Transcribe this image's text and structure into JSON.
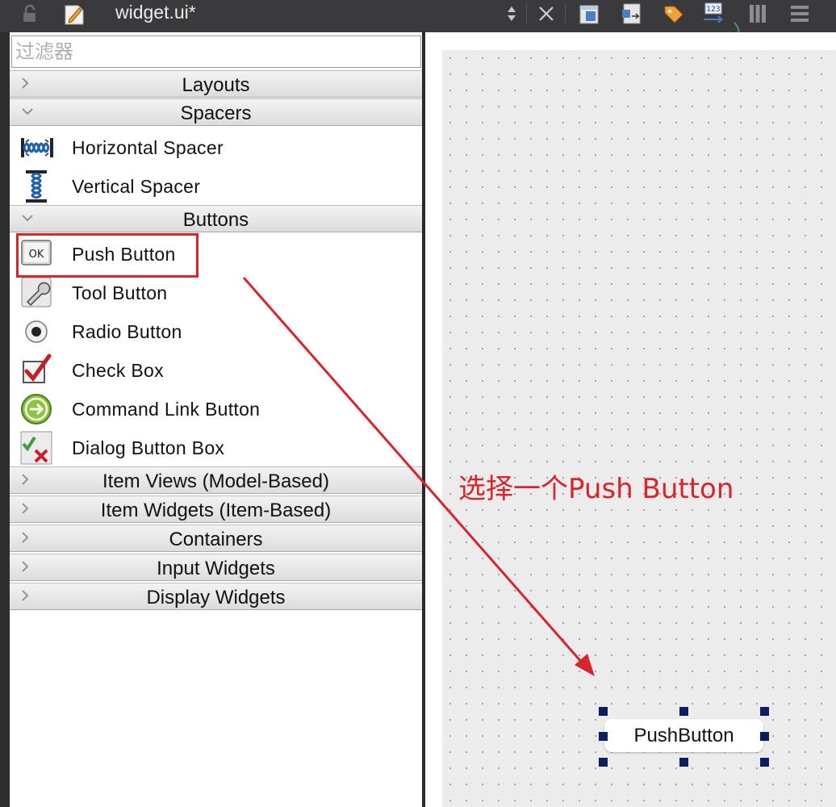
{
  "toolbar": {
    "title": "widget.ui*",
    "icons": [
      "lock-icon",
      "edit-icon",
      "spin-arrows-icon",
      "close-icon",
      "layout-icon",
      "layout-icon",
      "tag-icon",
      "tab-order-icon",
      "columns-icon",
      "rows-icon"
    ]
  },
  "widget_box": {
    "filter_placeholder": "过滤器",
    "categories": {
      "layouts": "Layouts",
      "spacers": "Spacers",
      "buttons": "Buttons",
      "item_views": "Item Views (Model-Based)",
      "item_widgets": "Item Widgets (Item-Based)",
      "containers": "Containers",
      "input_widgets": "Input Widgets",
      "display_widgets": "Display Widgets"
    },
    "spacers": [
      {
        "label": "Horizontal Spacer",
        "icon": "horizontal-spacer-icon"
      },
      {
        "label": "Vertical Spacer",
        "icon": "vertical-spacer-icon"
      }
    ],
    "buttons": [
      {
        "label": "Push Button",
        "icon": "push-button-icon",
        "icon_text": "OK"
      },
      {
        "label": "Tool Button",
        "icon": "tool-button-icon"
      },
      {
        "label": "Radio Button",
        "icon": "radio-button-icon"
      },
      {
        "label": "Check Box",
        "icon": "check-box-icon"
      },
      {
        "label": "Command Link Button",
        "icon": "command-link-icon"
      },
      {
        "label": "Dialog Button Box",
        "icon": "dialog-button-box-icon"
      }
    ]
  },
  "canvas": {
    "annotation": "选择一个Push Button",
    "push_button_label": "PushButton"
  },
  "colors": {
    "annotation_red": "#d9232d",
    "handle_navy": "#0f1c5e",
    "canvas_bg": "#ececec",
    "toolbar_bg": "#3a3a3d"
  }
}
